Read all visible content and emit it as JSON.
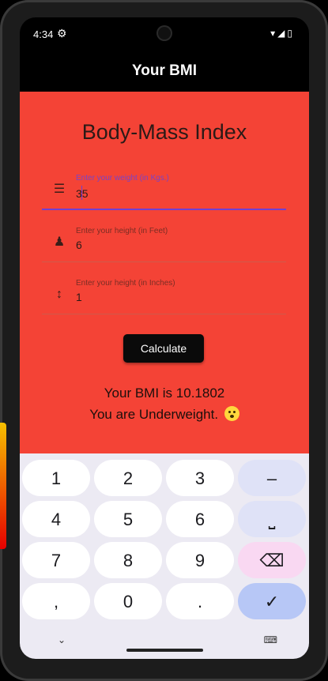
{
  "status_bar": {
    "time": "4:34",
    "settings_icon": "gear-icon",
    "signal_icons": "wifi-icon signal-icon battery-icon"
  },
  "app_bar": {
    "title": "Your BMI"
  },
  "main": {
    "heading": "Body-Mass Index",
    "fields": [
      {
        "label": "Enter your weight (in Kgs.)",
        "value": "35",
        "icon": "scale-icon"
      },
      {
        "label": "Enter your height (in Feet)",
        "value": "6",
        "icon": "person-icon"
      },
      {
        "label": "Enter your height (in Inches)",
        "value": "1",
        "icon": "vertical-arrows-icon"
      }
    ],
    "calculate_label": "Calculate",
    "result_line1": "Your BMI is 10.1802",
    "result_line2": "You are Underweight."
  },
  "keyboard": {
    "rows": [
      [
        "1",
        "2",
        "3",
        "–"
      ],
      [
        "4",
        "5",
        "6",
        "⎵"
      ],
      [
        "7",
        "8",
        "9",
        "⌫"
      ],
      [
        ",",
        "0",
        ".",
        "✓"
      ]
    ]
  },
  "colors": {
    "content_bg": "#f44336",
    "accent": "#6f3fd4",
    "keyboard_bg": "#eceaf3"
  }
}
